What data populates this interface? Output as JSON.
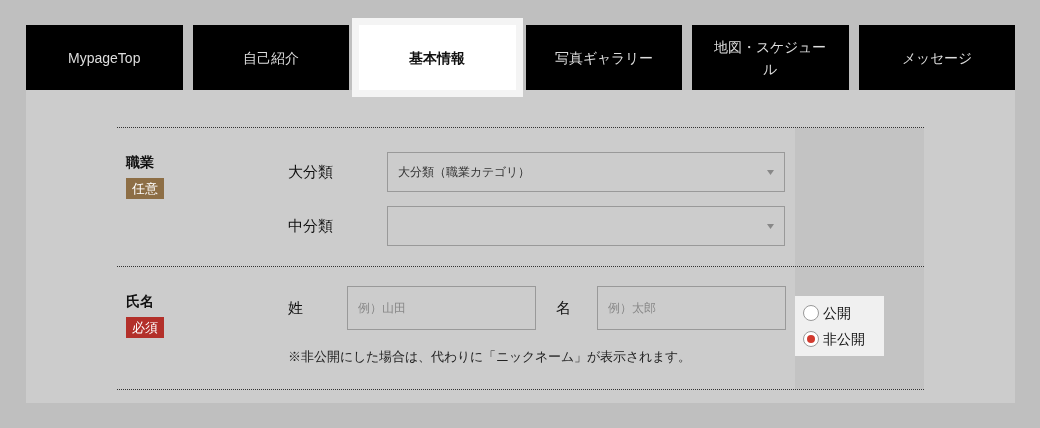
{
  "tabs": [
    {
      "label": "MypageTop",
      "selected": false
    },
    {
      "label": "自己紹介",
      "selected": false
    },
    {
      "label": "基本情報",
      "selected": true
    },
    {
      "label": "写真ギャラリー",
      "selected": false
    },
    {
      "label": "地図・スケジュール",
      "selected": false
    },
    {
      "label": "メッセージ",
      "selected": false
    }
  ],
  "form": {
    "rows": [
      {
        "kind": "selects",
        "label": "職業",
        "badge": {
          "text": "任意",
          "kind": "optional"
        },
        "selects": [
          {
            "label": "大分類",
            "value": "大分類（職業カテゴリ）"
          },
          {
            "label": "中分類"
          }
        ]
      },
      {
        "kind": "name",
        "label": "氏名",
        "badge": {
          "text": "必須",
          "kind": "required"
        },
        "fields": [
          {
            "label": "姓",
            "placeholder": "例）山田"
          },
          {
            "label": "名",
            "placeholder": "例）太郎"
          }
        ],
        "note": "※非公開にした場合は、代わりに「ニックネーム」が表示されます。",
        "visibility": [
          {
            "label": "公開",
            "selected": false
          },
          {
            "label": "非公開",
            "selected": true
          }
        ]
      }
    ]
  }
}
